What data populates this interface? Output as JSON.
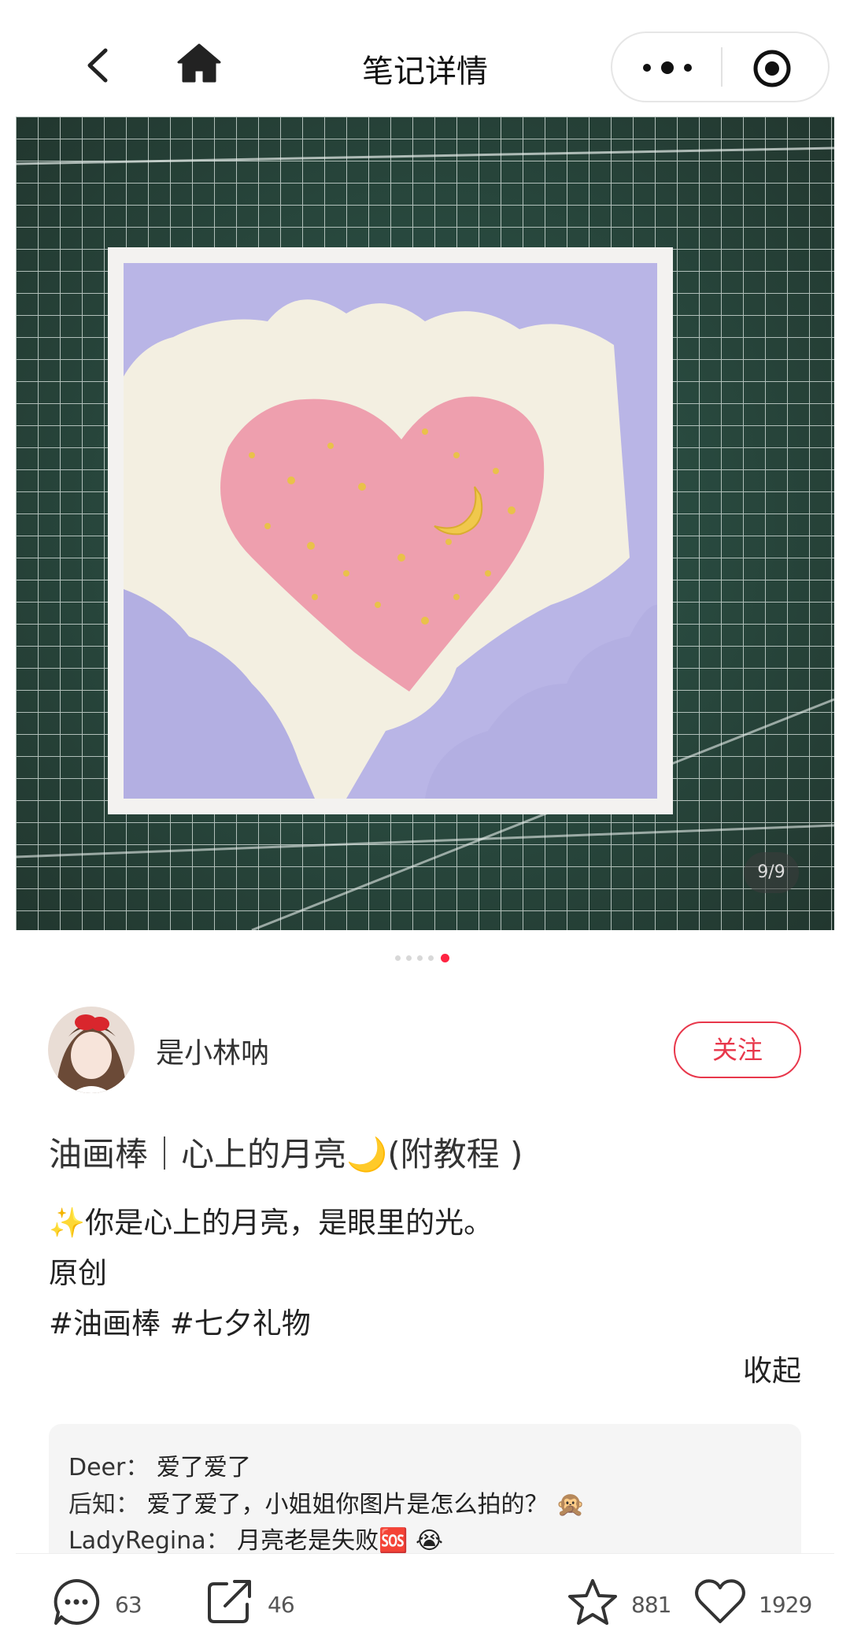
{
  "header": {
    "title": "笔记详情",
    "icons": [
      "back-icon",
      "home-icon",
      "more-icon",
      "target-icon"
    ]
  },
  "gallery": {
    "counter": "9/9",
    "current_index": 5,
    "total_dots": 5
  },
  "author": {
    "name": "是小林呐",
    "follow_label": "关注"
  },
  "note": {
    "title": "油画棒｜心上的月亮🌙(附教程 )",
    "lines": [
      "✨你是心上的月亮，是眼里的光。",
      "原创",
      "#油画棒 #七夕礼物"
    ],
    "collapse_label": "收起"
  },
  "comments": [
    {
      "user": "Deer：",
      "text": " 爱了爱了"
    },
    {
      "user": "后知：",
      "text": " 爱了爱了，小姐姐你图片是怎么拍的？ 🙊"
    },
    {
      "user": "LadyRegina：",
      "text": " 月亮老是失败🆘 😭"
    }
  ],
  "bottom_bar": {
    "comment_count": "63",
    "share_count": "46",
    "star_count": "881",
    "like_count": "1929"
  },
  "colors": {
    "accent": "#e8374b",
    "active_dot": "#ff2442",
    "lavender": "#b8b4e6",
    "heart_pink": "#ee9fae",
    "cream": "#f2eee0",
    "cutting_mat": "#2f4f45"
  }
}
